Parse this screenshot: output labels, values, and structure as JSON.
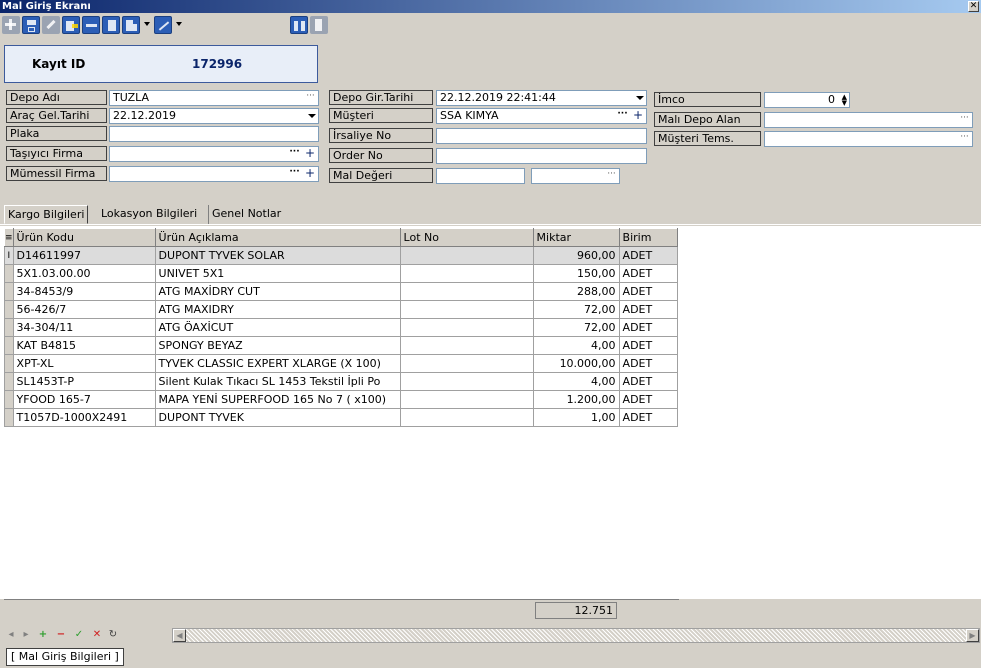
{
  "window": {
    "title": "Mal Giriş Ekranı",
    "close_label": "✕"
  },
  "toolbar": {
    "buttons": [
      {
        "name": "add-icon",
        "enabled": false
      },
      {
        "name": "save-icon",
        "enabled": true
      },
      {
        "name": "edit-icon",
        "enabled": false
      },
      {
        "name": "export-icon",
        "enabled": true
      },
      {
        "name": "delete-icon",
        "enabled": true
      },
      {
        "name": "document-icon",
        "enabled": true
      },
      {
        "name": "report-icon",
        "enabled": true
      },
      {
        "name": "chart-icon",
        "enabled": true
      },
      {
        "name": "binoculars-icon",
        "enabled": true
      },
      {
        "name": "exit-door-icon",
        "enabled": false
      }
    ]
  },
  "record": {
    "label": "Kayıt ID",
    "value": "172996"
  },
  "form": {
    "depo_adi": {
      "label": "Depo Adı",
      "value": "TUZLA"
    },
    "arac_gel_tarihi": {
      "label": "Araç Gel.Tarihi",
      "value": "22.12.2019"
    },
    "plaka": {
      "label": "Plaka",
      "value": ""
    },
    "tasiyici_firma": {
      "label": "Taşıyıcı Firma",
      "value": ""
    },
    "mumessil_firma": {
      "label": "Mümessil Firma",
      "value": ""
    },
    "depo_gir_tarihi": {
      "label": "Depo Gir.Tarihi",
      "value": "22.12.2019 22:41:44"
    },
    "musteri": {
      "label": "Müşteri",
      "value": "SSA KIMYA"
    },
    "irsaliye_no": {
      "label": "İrsaliye No",
      "value": ""
    },
    "order_no": {
      "label": "Order No",
      "value": ""
    },
    "mal_degeri": {
      "label": "Mal Değeri",
      "value": ""
    },
    "imco": {
      "label": "İmco",
      "value": "0"
    },
    "mali_depo_alan": {
      "label": "Malı Depo Alan",
      "value": ""
    },
    "musteri_tems": {
      "label": "Müşteri Tems.",
      "value": ""
    }
  },
  "tabs": [
    {
      "label": "Kargo Bilgileri",
      "active": true
    },
    {
      "label": "Lokasyon Bilgileri",
      "active": false
    },
    {
      "label": "Genel Notlar",
      "active": false
    }
  ],
  "grid": {
    "columns": [
      "Ürün Kodu",
      "Ürün Açıklama",
      "Lot No",
      "Miktar",
      "Birim"
    ],
    "rows": [
      [
        "D14611997",
        "DUPONT TYVEK SOLAR",
        "",
        "960,00",
        "ADET"
      ],
      [
        "5X1.03.00.00",
        "UNIVET 5X1",
        "",
        "150,00",
        "ADET"
      ],
      [
        "34-8453/9",
        "ATG MAXİDRY CUT",
        "",
        "288,00",
        "ADET"
      ],
      [
        "56-426/7",
        "ATG MAXIDRY",
        "",
        "72,00",
        "ADET"
      ],
      [
        "34-304/11",
        "ATG ÖAXİCUT",
        "",
        "72,00",
        "ADET"
      ],
      [
        "KAT B4815",
        "SPONGY BEYAZ",
        "",
        "4,00",
        "ADET"
      ],
      [
        "XPT-XL",
        "TYVEK CLASSIC EXPERT XLARGE (X 100)",
        "",
        "10.000,00",
        "ADET"
      ],
      [
        "SL1453T-P",
        "Silent Kulak Tıkacı SL 1453 Tekstil İpli Po",
        "",
        "4,00",
        "ADET"
      ],
      [
        "YFOOD 165-7",
        "MAPA YENİ SUPERFOOD 165 No 7 ( x100)",
        "",
        "1.200,00",
        "ADET"
      ],
      [
        "T1057D-1000X2491",
        "DUPONT TYVEK",
        "",
        "1,00",
        "ADET"
      ]
    ],
    "total": "12.751"
  },
  "status": {
    "tab_label": "[ Mal Giriş Bilgileri ]"
  },
  "colors": {
    "title_start": "#0a246a",
    "title_end": "#a6caf0",
    "record_value": "#0a246a"
  }
}
